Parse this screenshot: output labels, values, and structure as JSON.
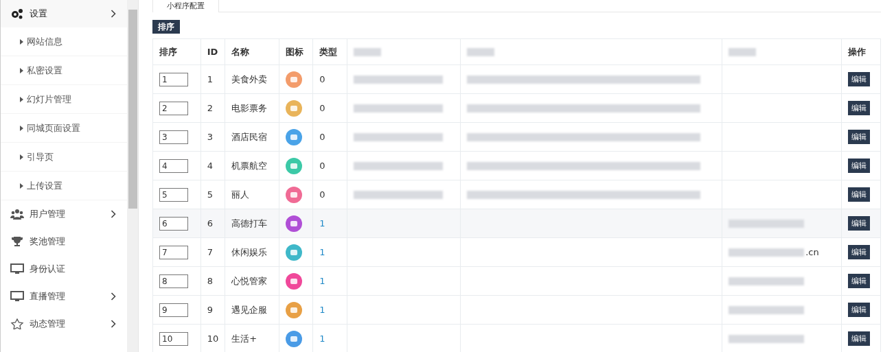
{
  "sidebar": {
    "items": [
      {
        "label": "设置",
        "selected": true,
        "has_arrow": true,
        "children": [
          {
            "label": "网站信息"
          },
          {
            "label": "私密设置"
          },
          {
            "label": "幻灯片管理"
          },
          {
            "label": "同城页面设置"
          },
          {
            "label": "引导页"
          },
          {
            "label": "上传设置"
          }
        ]
      },
      {
        "label": "用户管理",
        "selected": false,
        "has_arrow": true
      },
      {
        "label": "奖池管理",
        "selected": false,
        "has_arrow": false
      },
      {
        "label": "身份认证",
        "selected": false,
        "has_arrow": false
      },
      {
        "label": "直播管理",
        "selected": false,
        "has_arrow": true
      },
      {
        "label": "动态管理",
        "selected": false,
        "has_arrow": true
      }
    ]
  },
  "tabs": [
    {
      "label": "小程序配置",
      "selected": true
    }
  ],
  "sort_button": "排序",
  "table": {
    "columns": [
      "排序",
      "ID",
      "名称",
      "图标",
      "类型",
      {
        "redacted": true
      },
      {
        "redacted": true
      },
      {
        "redacted": true
      },
      "操作"
    ],
    "rows": [
      {
        "order": "1",
        "id": "1",
        "name": "美食外卖",
        "color": "#f39c6b",
        "type": "0",
        "col6": {
          "redacted": true
        },
        "col7": {
          "redacted": true
        },
        "col8": {
          "redacted": false
        },
        "action": "编辑",
        "highlighted": false
      },
      {
        "order": "2",
        "id": "2",
        "name": "电影票务",
        "color": "#e9b45a",
        "type": "0",
        "col6": {
          "redacted": true
        },
        "col7": {
          "redacted": true
        },
        "col8": {
          "redacted": false
        },
        "action": "编辑",
        "highlighted": false
      },
      {
        "order": "3",
        "id": "3",
        "name": "酒店民宿",
        "color": "#4aa3e8",
        "type": "0",
        "col6": {
          "redacted": true
        },
        "col7": {
          "redacted": true
        },
        "col8": {
          "redacted": false
        },
        "action": "编辑",
        "highlighted": false
      },
      {
        "order": "4",
        "id": "4",
        "name": "机票航空",
        "color": "#3cc9a7",
        "type": "0",
        "col6": {
          "redacted": true
        },
        "col7": {
          "redacted": true
        },
        "col8": {
          "redacted": false
        },
        "action": "编辑",
        "highlighted": false
      },
      {
        "order": "5",
        "id": "5",
        "name": "丽人",
        "color": "#f06b95",
        "type": "0",
        "col6": {
          "redacted": true
        },
        "col7": {
          "redacted": true
        },
        "col8": {
          "redacted": false
        },
        "action": "编辑",
        "highlighted": false
      },
      {
        "order": "6",
        "id": "6",
        "name": "高德打车",
        "color": "#b04fd6",
        "type": "1",
        "col6": {
          "redacted": false
        },
        "col7": {
          "redacted": false
        },
        "col8": {
          "redacted": true
        },
        "action": "编辑",
        "highlighted": true
      },
      {
        "order": "7",
        "id": "7",
        "name": "休闲娱乐",
        "color": "#3fb8c9",
        "type": "1",
        "col6": {
          "redacted": false
        },
        "col7": {
          "redacted": false
        },
        "col8": {
          "redacted": true,
          "text": ".cn"
        },
        "action": "编辑",
        "highlighted": false
      },
      {
        "order": "8",
        "id": "8",
        "name": "心悦管家",
        "color": "#f0489a",
        "type": "1",
        "col6": {
          "redacted": false
        },
        "col7": {
          "redacted": false
        },
        "col8": {
          "redacted": true
        },
        "action": "编辑",
        "highlighted": false
      },
      {
        "order": "9",
        "id": "9",
        "name": "遇见企服",
        "color": "#e8a045",
        "type": "1",
        "col6": {
          "redacted": false
        },
        "col7": {
          "redacted": false
        },
        "col8": {
          "redacted": true
        },
        "action": "编辑",
        "highlighted": false
      },
      {
        "order": "10",
        "id": "10",
        "name": "生活+",
        "color": "#4a9be6",
        "type": "1",
        "col6": {
          "redacted": false
        },
        "col7": {
          "redacted": false
        },
        "col8": {
          "redacted": true
        },
        "action": "编辑",
        "highlighted": false
      }
    ]
  }
}
